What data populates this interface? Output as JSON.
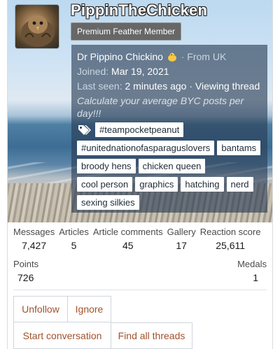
{
  "profile": {
    "username": "PippinTheChicken",
    "member_title": "Premium Feather Member",
    "real_name": "Dr Pippino Chickino",
    "location": "· From UK",
    "joined_label": "Joined:",
    "joined_date": "Mar 19, 2021",
    "last_seen_label": "Last seen:",
    "last_seen_value": "2 minutes ago",
    "activity": "· Viewing thread",
    "signature_note": "Calculate your average BYC posts per day!!!",
    "tags": [
      "#teampocketpeanut",
      "#unitednationofasparaguslovers",
      "bantams",
      "broody hens",
      "chicken queen",
      "cool person",
      "graphics",
      "hatching",
      "nerd",
      "sexing silkies"
    ]
  },
  "stats": {
    "messages": {
      "label": "Messages",
      "value": "7,427"
    },
    "articles": {
      "label": "Articles",
      "value": "5"
    },
    "article_comments": {
      "label": "Article comments",
      "value": "45"
    },
    "gallery": {
      "label": "Gallery",
      "value": "17"
    },
    "reaction_score": {
      "label": "Reaction score",
      "value": "25,611"
    },
    "points": {
      "label": "Points",
      "value": "726"
    },
    "medals": {
      "label": "Medals",
      "value": "1"
    }
  },
  "actions": {
    "unfollow": "Unfollow",
    "ignore": "Ignore",
    "start_conversation": "Start conversation",
    "find_all_threads": "Find all threads"
  },
  "colors": {
    "action_text": "#a0522d",
    "info_overlay": "#263a52",
    "badge_bg": "#676767"
  },
  "icons": {
    "tags": "tag-icon",
    "location_emoji": "chick-emoji-icon"
  }
}
